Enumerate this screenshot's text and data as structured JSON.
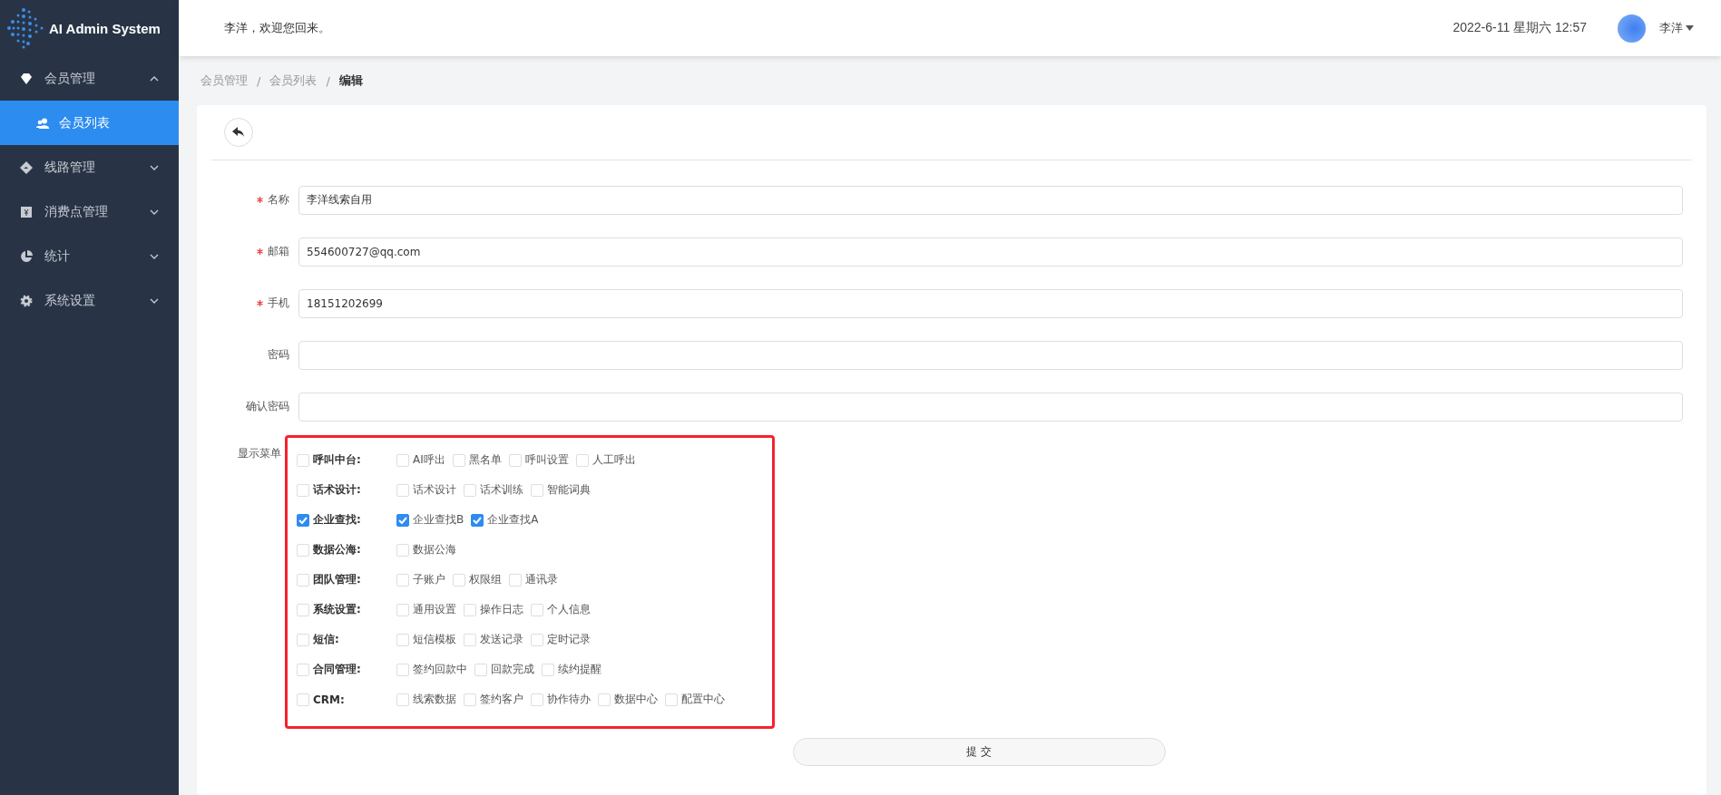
{
  "sidebar": {
    "logo_text": "AI Admin System",
    "items": [
      {
        "label": "会员管理",
        "expanded": true,
        "children": [
          {
            "label": "会员列表",
            "selected": true
          }
        ]
      },
      {
        "label": "线路管理",
        "expanded": false
      },
      {
        "label": "消费点管理",
        "expanded": false
      },
      {
        "label": "统计",
        "expanded": false
      },
      {
        "label": "系统设置",
        "expanded": false
      }
    ]
  },
  "header": {
    "welcome": "李洋，欢迎您回来。",
    "datetime": "2022-6-11 星期六 12:57",
    "user": "李洋"
  },
  "breadcrumb": {
    "separator": "/",
    "items": [
      "会员管理",
      "会员列表",
      "编辑"
    ]
  },
  "form": {
    "fields": [
      {
        "label": "名称",
        "required": true,
        "value": "李洋线索自用"
      },
      {
        "label": "邮箱",
        "required": true,
        "value": "554600727@qq.com"
      },
      {
        "label": "手机",
        "required": true,
        "value": "18151202699"
      },
      {
        "label": "密码",
        "required": false
      },
      {
        "label": "确认密码",
        "required": false
      }
    ],
    "menu_label": "显示菜单",
    "menu_groups": [
      {
        "label": "呼叫中台:",
        "checked": false,
        "options": [
          {
            "label": "AI呼出",
            "checked": false
          },
          {
            "label": "黑名单",
            "checked": false
          },
          {
            "label": "呼叫设置",
            "checked": false
          },
          {
            "label": "人工呼出",
            "checked": false
          }
        ]
      },
      {
        "label": "话术设计:",
        "checked": false,
        "options": [
          {
            "label": "话术设计",
            "checked": false
          },
          {
            "label": "话术训练",
            "checked": false
          },
          {
            "label": "智能词典",
            "checked": false
          }
        ]
      },
      {
        "label": "企业查找:",
        "checked": true,
        "options": [
          {
            "label": "企业查找B",
            "checked": true
          },
          {
            "label": "企业查找A",
            "checked": true
          }
        ]
      },
      {
        "label": "数据公海:",
        "checked": false,
        "options": [
          {
            "label": "数据公海",
            "checked": false
          }
        ]
      },
      {
        "label": "团队管理:",
        "checked": false,
        "options": [
          {
            "label": "子账户",
            "checked": false
          },
          {
            "label": "权限组",
            "checked": false
          },
          {
            "label": "通讯录",
            "checked": false
          }
        ]
      },
      {
        "label": "系统设置:",
        "checked": false,
        "options": [
          {
            "label": "通用设置",
            "checked": false
          },
          {
            "label": "操作日志",
            "checked": false
          },
          {
            "label": "个人信息",
            "checked": false
          }
        ]
      },
      {
        "label": "短信:",
        "checked": false,
        "options": [
          {
            "label": "短信模板",
            "checked": false
          },
          {
            "label": "发送记录",
            "checked": false
          },
          {
            "label": "定时记录",
            "checked": false
          }
        ]
      },
      {
        "label": "合同管理:",
        "checked": false,
        "options": [
          {
            "label": "签约回款中",
            "checked": false
          },
          {
            "label": "回款完成",
            "checked": false
          },
          {
            "label": "续约提醒",
            "checked": false
          }
        ]
      },
      {
        "label": "CRM:",
        "checked": false,
        "options": [
          {
            "label": "线索数据",
            "checked": false
          },
          {
            "label": "签约客户",
            "checked": false
          },
          {
            "label": "协作待办",
            "checked": false
          },
          {
            "label": "数据中心",
            "checked": false
          },
          {
            "label": "配置中心",
            "checked": false
          }
        ]
      }
    ],
    "submit": "提 交"
  }
}
